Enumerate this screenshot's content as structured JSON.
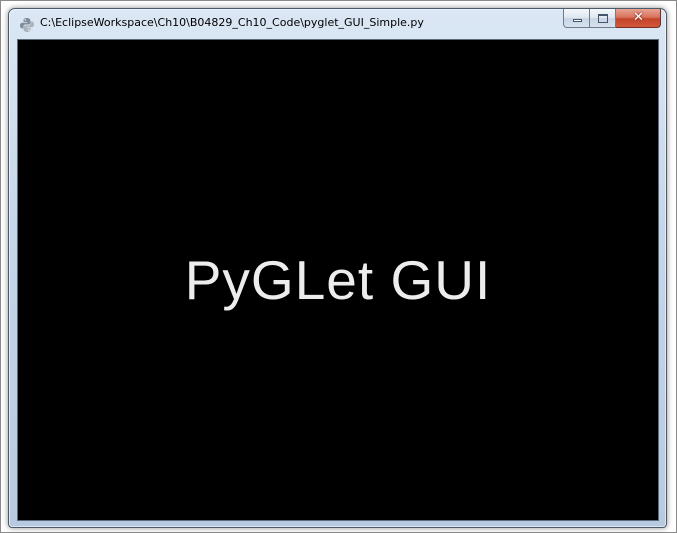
{
  "window": {
    "title": "C:\\EclipseWorkspace\\Ch10\\B04829_Ch10_Code\\pyglet_GUI_Simple.py",
    "icon": "python-icon",
    "caption_buttons": {
      "minimize": "minimize-icon",
      "maximize": "maximize-icon",
      "close": "close-icon",
      "close_glyph": "✕"
    }
  },
  "canvas": {
    "background": "#000000",
    "label": "PyGLet GUI",
    "label_color": "#ededed"
  }
}
